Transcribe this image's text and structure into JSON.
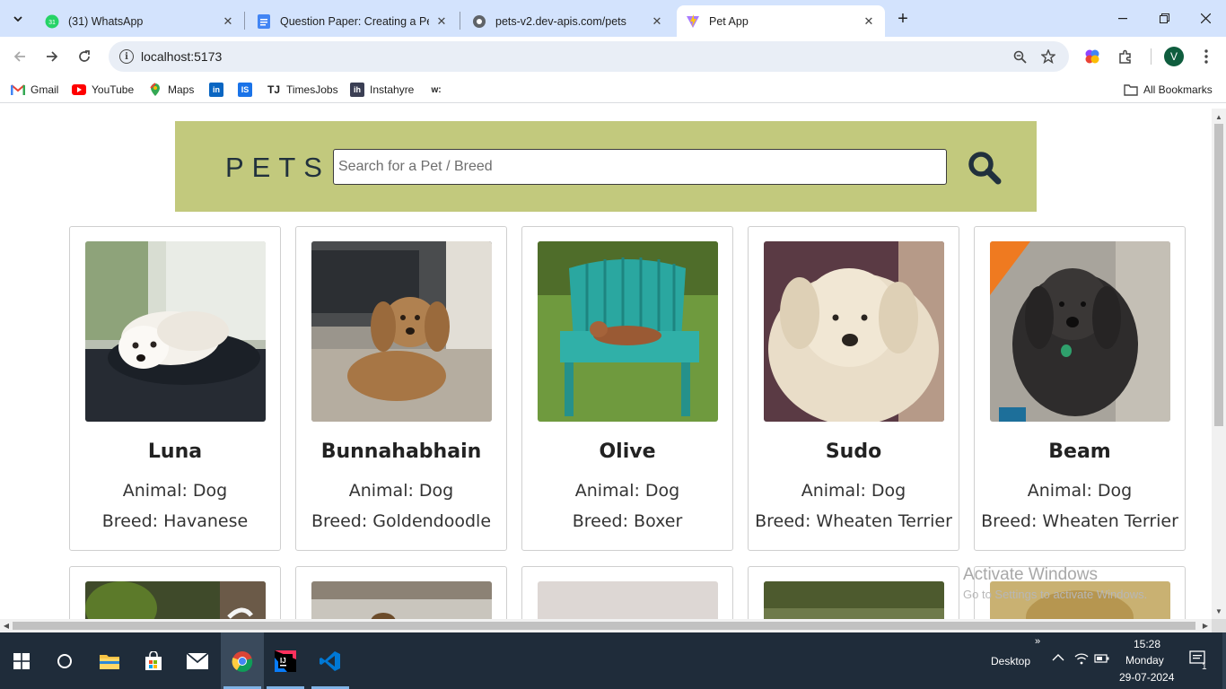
{
  "browser": {
    "tabs": [
      {
        "title": "(31) WhatsApp",
        "badge": "31",
        "favicon": "whatsapp-icon"
      },
      {
        "title": "Question Paper: Creating a Pet A",
        "favicon": "docs-icon"
      },
      {
        "title": "pets-v2.dev-apis.com/pets",
        "favicon": "globe-icon"
      },
      {
        "title": "Pet App",
        "favicon": "vite-icon"
      }
    ],
    "url": "localhost:5173",
    "profile_initial": "V",
    "bookmarks": [
      {
        "label": "Gmail",
        "icon": "gmail-icon"
      },
      {
        "label": "YouTube",
        "icon": "youtube-icon"
      },
      {
        "label": "Maps",
        "icon": "maps-icon"
      },
      {
        "label": "",
        "icon": "linkedin-icon",
        "glyph": "in"
      },
      {
        "label": "",
        "icon": "iimjobs-icon",
        "glyph": "IS"
      },
      {
        "label": "TimesJobs",
        "icon": "timesjobs-icon",
        "glyph": "TJ"
      },
      {
        "label": "Instahyre",
        "icon": "instahyre-icon",
        "glyph": "ih"
      },
      {
        "label": "",
        "icon": "w-icon",
        "glyph": "w:"
      }
    ],
    "all_bookmarks": "All Bookmarks"
  },
  "app": {
    "brand": "PETS",
    "search_placeholder": "Search for a Pet / Breed",
    "pets": [
      {
        "name": "Luna",
        "animal": "Animal: Dog",
        "breed": "Breed: Havanese"
      },
      {
        "name": "Bunnahabhain",
        "animal": "Animal: Dog",
        "breed": "Breed: Goldendoodle"
      },
      {
        "name": "Olive",
        "animal": "Animal: Dog",
        "breed": "Breed: Boxer"
      },
      {
        "name": "Sudo",
        "animal": "Animal: Dog",
        "breed": "Breed: Wheaten Terrier"
      },
      {
        "name": "Beam",
        "animal": "Animal: Dog",
        "breed": "Breed: Wheaten Terrier"
      }
    ]
  },
  "os": {
    "watermark_title": "Activate Windows",
    "watermark_sub": "Go to Settings to activate Windows.",
    "desktop_label": "Desktop",
    "time": "15:28",
    "day": "Monday",
    "date": "29-07-2024",
    "notification_count": "1"
  }
}
